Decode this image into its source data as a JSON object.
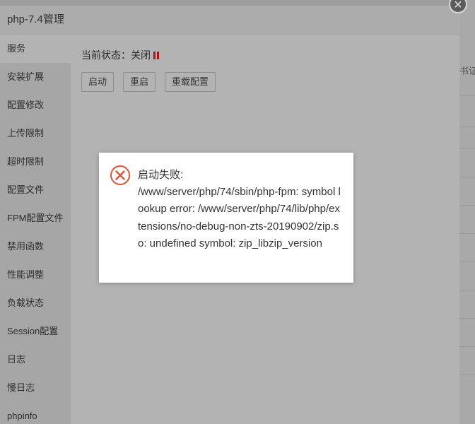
{
  "background": {
    "partial_text": "书证书"
  },
  "dialog": {
    "title": "php-7.4管理",
    "close_label": "×"
  },
  "sidebar": {
    "items": [
      {
        "label": "服务",
        "active": true
      },
      {
        "label": "安装扩展"
      },
      {
        "label": "配置修改"
      },
      {
        "label": "上传限制"
      },
      {
        "label": "超时限制"
      },
      {
        "label": "配置文件"
      },
      {
        "label": "FPM配置文件"
      },
      {
        "label": "禁用函数"
      },
      {
        "label": "性能调整"
      },
      {
        "label": "负载状态"
      },
      {
        "label": "Session配置"
      },
      {
        "label": "日志"
      },
      {
        "label": "慢日志"
      },
      {
        "label": "phpinfo"
      }
    ]
  },
  "service": {
    "status_label": "当前状态：",
    "status_value": "关闭",
    "status_icon": "pause-icon",
    "status_color": "#b01515",
    "buttons": [
      {
        "label": "启动"
      },
      {
        "label": "重启"
      },
      {
        "label": "重载配置"
      }
    ]
  },
  "message": {
    "icon": "error-circle-icon",
    "icon_color": "#e8503a",
    "title": "启动失败:",
    "body": "/www/server/php/74/sbin/php-fpm: symbol lookup error: /www/server/php/74/lib/php/extensions/no-debug-non-zts-20190902/zip.so: undefined symbol: zip_libzip_version"
  }
}
